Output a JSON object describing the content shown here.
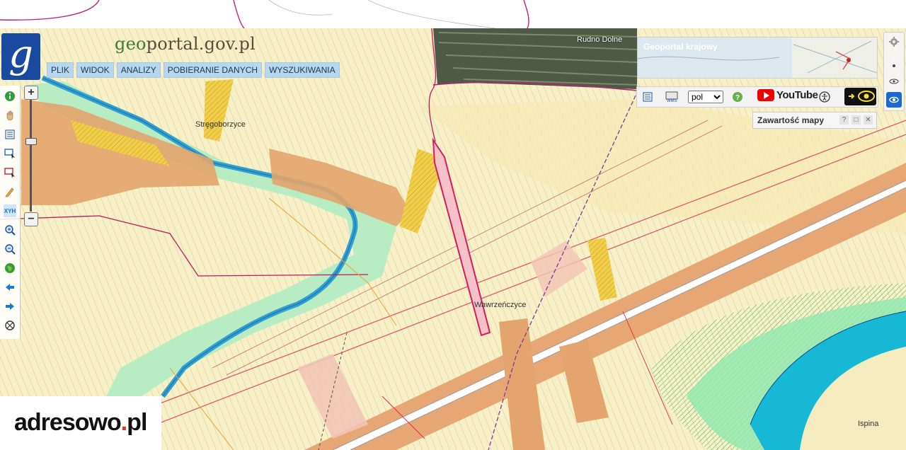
{
  "site": {
    "name_prefix": "geo",
    "name_rest": "portal.gov.pl",
    "logo_letter": "g"
  },
  "menu": {
    "items": [
      "PLIK",
      "WIDOK",
      "ANALIZY",
      "POBIERANIE DANYCH",
      "WYSZUKIWANIA"
    ]
  },
  "overview": {
    "label": "Geoportal krajowy"
  },
  "toolbar": {
    "language_selected": "pol",
    "youtube_label": "YouTube",
    "help_glyph": "?"
  },
  "content_panel": {
    "title": "Zawartość mapy",
    "help": "?",
    "max": "□",
    "close": "✕"
  },
  "map": {
    "places": {
      "strzegoborzyce": "Stręgoborzyce",
      "wawrzenczyce": "Wawrzeńczyce",
      "rudno": "Rudno Dolne",
      "ispina": "Ispina"
    }
  },
  "zoom": {
    "in": "+",
    "out": "−"
  },
  "watermark": {
    "name": "adresowo",
    "dot": ".",
    "tld": "pl"
  },
  "icons": {
    "left_toolbar": [
      "info-icon",
      "pan-hand-icon",
      "legend-icon",
      "select-box-icon",
      "select-red-icon",
      "draw-pencil-icon",
      "xyh-icon",
      "zoom-in-icon",
      "zoom-out-icon",
      "globe-icon",
      "back-arrow-icon",
      "forward-arrow-icon",
      "clear-icon"
    ],
    "right_toolbar": [
      "legend-icon",
      "wms-icon",
      "help-icon",
      "youtube-icon",
      "accessibility-icon",
      "eye-icon"
    ]
  },
  "colors": {
    "parcel_yellow": "#f7f0c4",
    "residential_orange": "#e0a068",
    "river_blue": "#3aa6d8",
    "floodplain_green": "#a8e6b4",
    "selected_parcel": "#d81b60",
    "brand_blue": "#1a4aa0"
  }
}
